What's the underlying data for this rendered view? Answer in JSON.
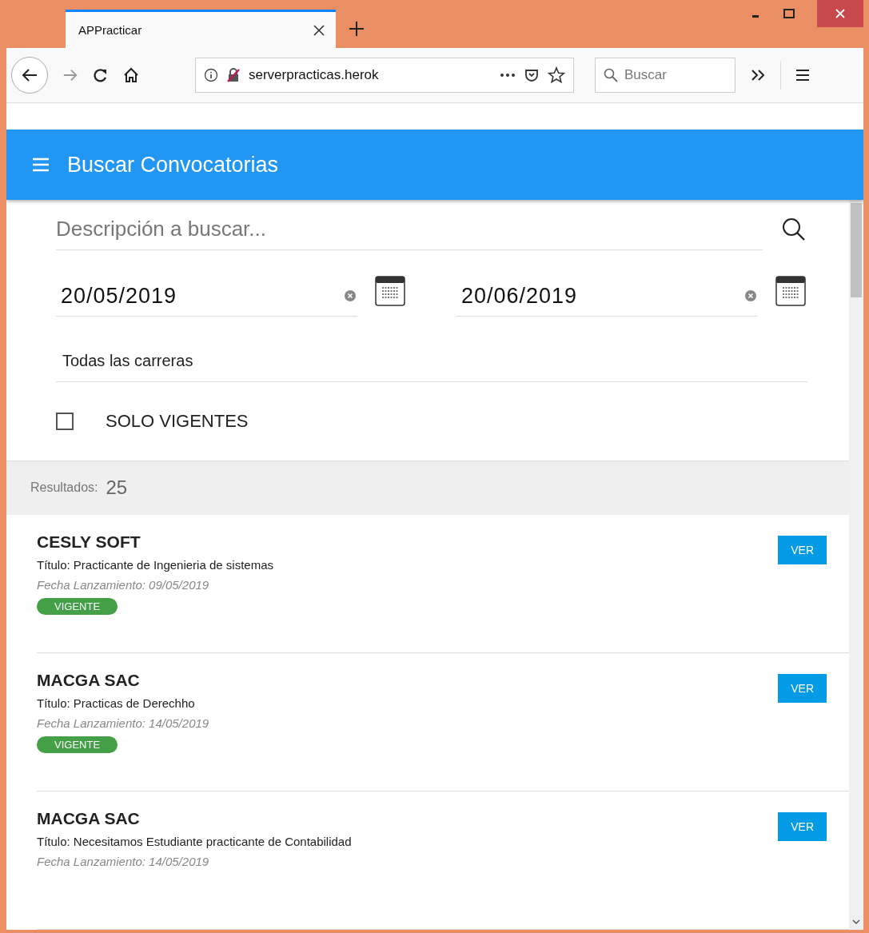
{
  "browser": {
    "tab_title": "APPracticar",
    "url": "serverpracticas.herok",
    "search_placeholder": "Buscar"
  },
  "app_bar": {
    "title": "Buscar Convocatorias"
  },
  "form": {
    "description_placeholder": "Descripción a buscar...",
    "date_from": "20/05/2019",
    "date_to": "20/06/2019",
    "career": "Todas las carreras",
    "only_current": {
      "label": "SOLO VIGENTES",
      "checked": false
    }
  },
  "results": {
    "label": "Resultados:",
    "count": "25",
    "items": [
      {
        "company": "CESLY SOFT",
        "title": "Título: Practicante de Ingenieria de sistemas",
        "date": "Fecha Lanzamiento: 09/05/2019",
        "badge": "VIGENTE",
        "button": "VER"
      },
      {
        "company": "MACGA SAC",
        "title": "Título: Practicas de Derechho",
        "date": "Fecha Lanzamiento: 14/05/2019",
        "badge": "VIGENTE",
        "button": "VER"
      },
      {
        "company": "MACGA SAC",
        "title": "Título: Necesitamos Estudiante practicante de Contabilidad",
        "date": "Fecha Lanzamiento: 14/05/2019",
        "button": "VER"
      }
    ]
  }
}
